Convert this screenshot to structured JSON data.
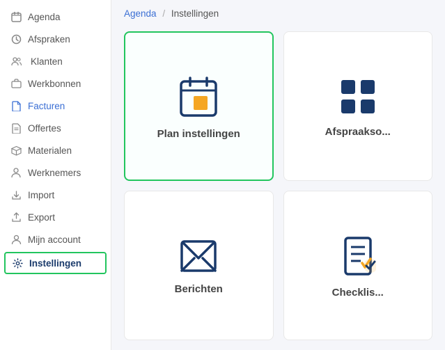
{
  "sidebar": {
    "items": [
      {
        "id": "agenda",
        "label": "Agenda",
        "icon": "calendar-icon"
      },
      {
        "id": "afspraken",
        "label": "Afspraken",
        "icon": "clock-icon"
      },
      {
        "id": "klanten",
        "label": "Klanten",
        "icon": "users-icon"
      },
      {
        "id": "werkbonnen",
        "label": "Werkbonnen",
        "icon": "briefcase-icon"
      },
      {
        "id": "facturen",
        "label": "Facturen",
        "icon": "file-icon",
        "blue": true
      },
      {
        "id": "offertes",
        "label": "Offertes",
        "icon": "doc-icon"
      },
      {
        "id": "materialen",
        "label": "Materialen",
        "icon": "box-icon"
      },
      {
        "id": "werknemers",
        "label": "Werknemers",
        "icon": "person-icon"
      },
      {
        "id": "import",
        "label": "Import",
        "icon": "import-icon"
      },
      {
        "id": "export",
        "label": "Export",
        "icon": "export-icon"
      },
      {
        "id": "mijn-account",
        "label": "Mijn account",
        "icon": "account-icon"
      },
      {
        "id": "instellingen",
        "label": "Instellingen",
        "icon": "gear-icon",
        "active": true
      }
    ]
  },
  "breadcrumb": {
    "link": "Agenda",
    "separator": "/",
    "current": "Instellingen"
  },
  "cards": [
    {
      "id": "plan-instellingen",
      "label": "Plan instellingen",
      "icon": "calendar-settings-icon",
      "selected": true
    },
    {
      "id": "afspraaksoort",
      "label": "Afspraakso...",
      "icon": "grid-icon",
      "selected": false
    },
    {
      "id": "berichten",
      "label": "Berichten",
      "icon": "envelope-icon",
      "selected": false
    },
    {
      "id": "checklist",
      "label": "Checklis...",
      "icon": "checklist-icon",
      "selected": false
    }
  ]
}
